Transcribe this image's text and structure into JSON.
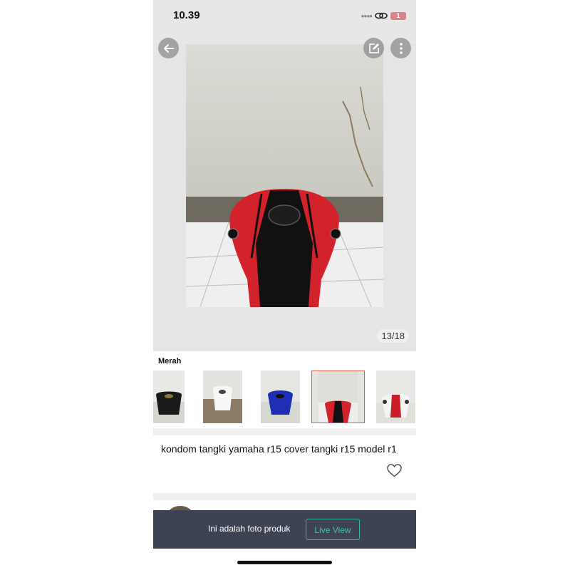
{
  "status_bar": {
    "time": "10.39",
    "battery_level": "1",
    "battery_color": "#d7848a"
  },
  "gallery": {
    "counter": "13/18"
  },
  "variants": {
    "label": "Merah",
    "items": [
      {
        "name": "black-tank",
        "selected": false
      },
      {
        "name": "white-tank",
        "selected": false
      },
      {
        "name": "blue-tank",
        "selected": false
      },
      {
        "name": "red-tank",
        "selected": true
      },
      {
        "name": "white-red-tank",
        "selected": false
      }
    ]
  },
  "product": {
    "title": "kondom tangki yamaha r15 cover tangki r15 model r1"
  },
  "banner": {
    "text": "Ini adalah foto produk",
    "button_label": "Live View"
  },
  "colors": {
    "accent": "#2fb7a8",
    "selected_border": "#e25b46",
    "banner_bg": "#3d4352"
  },
  "icons": [
    "back-arrow-icon",
    "edit-icon",
    "more-vertical-icon",
    "heart-icon",
    "link-icon"
  ]
}
